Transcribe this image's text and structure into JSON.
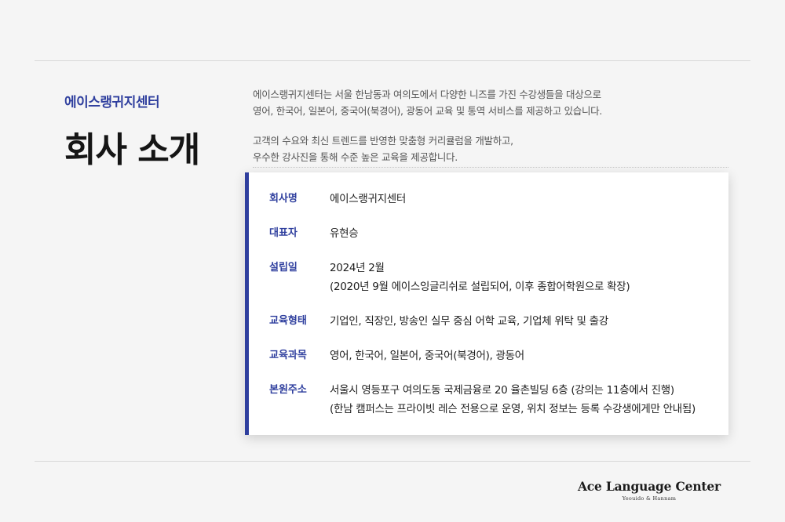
{
  "header": {
    "brand_sub": "에이스랭귀지센터",
    "title": "회사 소개"
  },
  "intro": {
    "p1_line1": "에이스랭귀지센터는 서울 한남동과 여의도에서 다양한 니즈를 가진 수강생들을 대상으로",
    "p1_line2": "영어, 한국어, 일본어, 중국어(북경어), 광동어 교육 및 통역 서비스를 제공하고 있습니다.",
    "p2_line1": "고객의 수요와 최신 트렌드를 반영한 맞춤형 커리큘럼을 개발하고,",
    "p2_line2": "우수한 강사진을 통해 수준 높은 교육을 제공합니다."
  },
  "info": {
    "company_label": "회사명",
    "company_value": "에이스랭귀지센터",
    "ceo_label": "대표자",
    "ceo_value": "유현승",
    "founded_label": "설립일",
    "founded_value1": "2024년 2월",
    "founded_value2": "(2020년 9월 에이스잉글리쉬로 설립되어, 이후 종합어학원으로 확장)",
    "type_label": "교육형태",
    "type_value": "기업인, 직장인, 방송인 실무 중심 어학 교육, 기업체 위탁 및 출강",
    "courses_label": "교육과목",
    "courses_value": "영어, 한국어, 일본어, 중국어(북경어), 광동어",
    "address_label": "본원주소",
    "address_value1": "서울시 영등포구 여의도동 국제금융로 20 율촌빌딩 6층 (강의는 11층에서 진행)",
    "address_value2": "(한남 캠퍼스는 프라이빗 레슨 전용으로 운영, 위치 정보는 등록 수강생에게만 안내됨)"
  },
  "footer": {
    "logo_main": "Ace Language Center",
    "logo_sub": "Yeouido & Hannam"
  },
  "colors": {
    "accent": "#2f3f9e",
    "background": "#f5f5f5",
    "card": "#ffffff"
  }
}
